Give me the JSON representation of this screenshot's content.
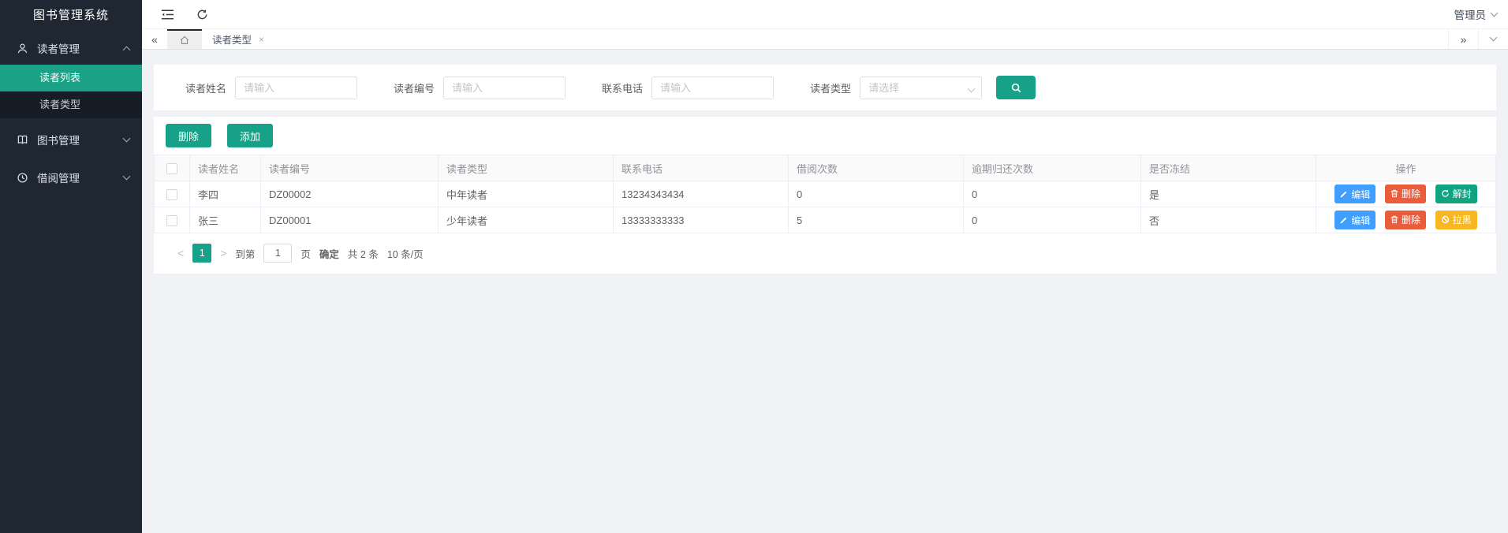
{
  "app": {
    "title": "图书管理系统"
  },
  "topbar": {
    "admin_label": "管理员"
  },
  "sidebar": {
    "menus": [
      {
        "label": "读者管理",
        "icon": "user-icon",
        "expanded": true,
        "children": [
          {
            "label": "读者列表",
            "active": true
          },
          {
            "label": "读者类型",
            "active": false
          }
        ]
      },
      {
        "label": "图书管理",
        "icon": "book-icon",
        "expanded": false
      },
      {
        "label": "借阅管理",
        "icon": "clock-icon",
        "expanded": false
      }
    ]
  },
  "tabs": {
    "collapse_left_icon": "«",
    "collapse_right_icon": "»",
    "active_tab": "读者类型",
    "close_icon": "×"
  },
  "search_form": {
    "fields": [
      {
        "label": "读者姓名",
        "placeholder": "请输入",
        "type": "text"
      },
      {
        "label": "读者编号",
        "placeholder": "请输入",
        "type": "text"
      },
      {
        "label": "联系电话",
        "placeholder": "请输入",
        "type": "text"
      },
      {
        "label": "读者类型",
        "placeholder": "请选择",
        "type": "select"
      }
    ]
  },
  "toolbar": {
    "delete_label": "删除",
    "add_label": "添加"
  },
  "table": {
    "columns": [
      "读者姓名",
      "读者编号",
      "读者类型",
      "联系电话",
      "借阅次数",
      "逾期归还次数",
      "是否冻结",
      "操作"
    ],
    "rows": [
      {
        "name": "李四",
        "code": "DZ00002",
        "type": "中年读者",
        "phone": "13234343434",
        "borrow_count": "0",
        "overdue_count": "0",
        "frozen": "是",
        "actions": [
          "编辑",
          "删除",
          "解封"
        ]
      },
      {
        "name": "张三",
        "code": "DZ00001",
        "type": "少年读者",
        "phone": "13333333333",
        "borrow_count": "5",
        "overdue_count": "0",
        "frozen": "否",
        "actions": [
          "编辑",
          "删除",
          "拉黑"
        ]
      }
    ]
  },
  "pagination": {
    "prev_icon": "<",
    "current_page": "1",
    "next_icon": ">",
    "goto_prefix": "到第",
    "goto_value": "1",
    "goto_suffix": "页",
    "confirm_label": "确定",
    "total_label": "共 2 条",
    "page_size_label": "10 条/页"
  },
  "colors": {
    "accent_teal": "#17a188",
    "sidebar_bg": "#1f2733",
    "submenu_bg": "#161d26",
    "edit_blue": "#409eff",
    "delete_red": "#e95d3c",
    "unfreeze_green": "#0fa382",
    "blacklist_yellow": "#f6b723",
    "page_bg": "#f0f2f5"
  }
}
